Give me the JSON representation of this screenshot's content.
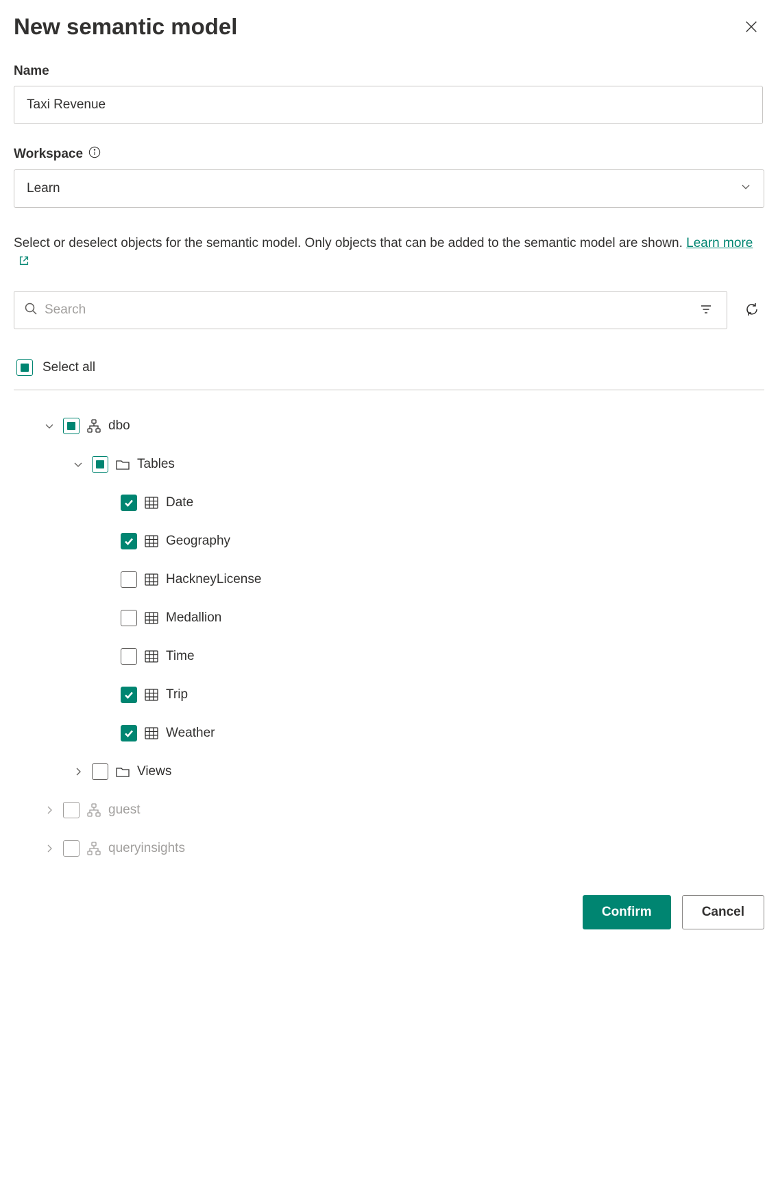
{
  "title": "New semantic model",
  "nameLabel": "Name",
  "nameValue": "Taxi Revenue",
  "workspaceLabel": "Workspace",
  "workspaceValue": "Learn",
  "description": "Select or deselect objects for the semantic model. Only objects that can be added to the semantic model are shown. ",
  "learnMore": "Learn more ",
  "searchPlaceholder": "Search",
  "selectAll": "Select all",
  "tree": {
    "dbo": "dbo",
    "tables": "Tables",
    "tableItems": [
      {
        "name": "Date",
        "checked": true
      },
      {
        "name": "Geography",
        "checked": true
      },
      {
        "name": "HackneyLicense",
        "checked": false
      },
      {
        "name": "Medallion",
        "checked": false
      },
      {
        "name": "Time",
        "checked": false
      },
      {
        "name": "Trip",
        "checked": true
      },
      {
        "name": "Weather",
        "checked": true
      }
    ],
    "views": "Views",
    "guest": "guest",
    "queryinsights": "queryinsights"
  },
  "confirmLabel": "Confirm",
  "cancelLabel": "Cancel"
}
